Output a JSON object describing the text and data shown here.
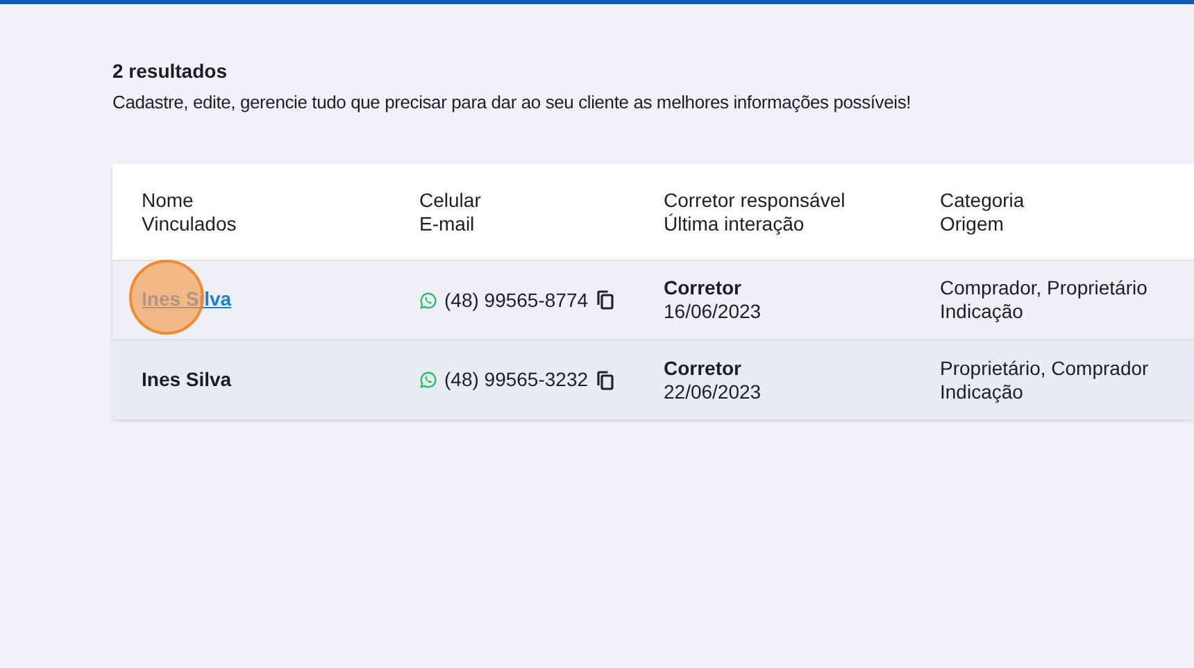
{
  "summary": {
    "count": "2 resultados",
    "description": "Cadastre, edite, gerencie tudo que precisar para dar ao seu cliente as melhores informações possíveis!"
  },
  "table": {
    "columns": [
      {
        "line_1": "Nome",
        "line_2": "Vinculados"
      },
      {
        "line_1": "Celular",
        "line_2": "E-mail"
      },
      {
        "line_1": "Corretor responsável",
        "line_2": "Última interação"
      },
      {
        "line_1": "Categoria",
        "line_2": "Origem"
      }
    ],
    "rows": [
      {
        "name": "Ines Silva",
        "link": true,
        "click_marker": true,
        "phone": "(48) 99565-8774",
        "broker": "Corretor",
        "date": "16/06/2023",
        "category": "Comprador, Proprietário",
        "origin": "Indicação"
      },
      {
        "name": "Ines Silva",
        "link": false,
        "click_marker": false,
        "phone": "(48) 99565-3232",
        "broker": "Corretor",
        "date": "22/06/2023",
        "category": "Proprietário, Comprador",
        "origin": "Indicação"
      }
    ]
  }
}
